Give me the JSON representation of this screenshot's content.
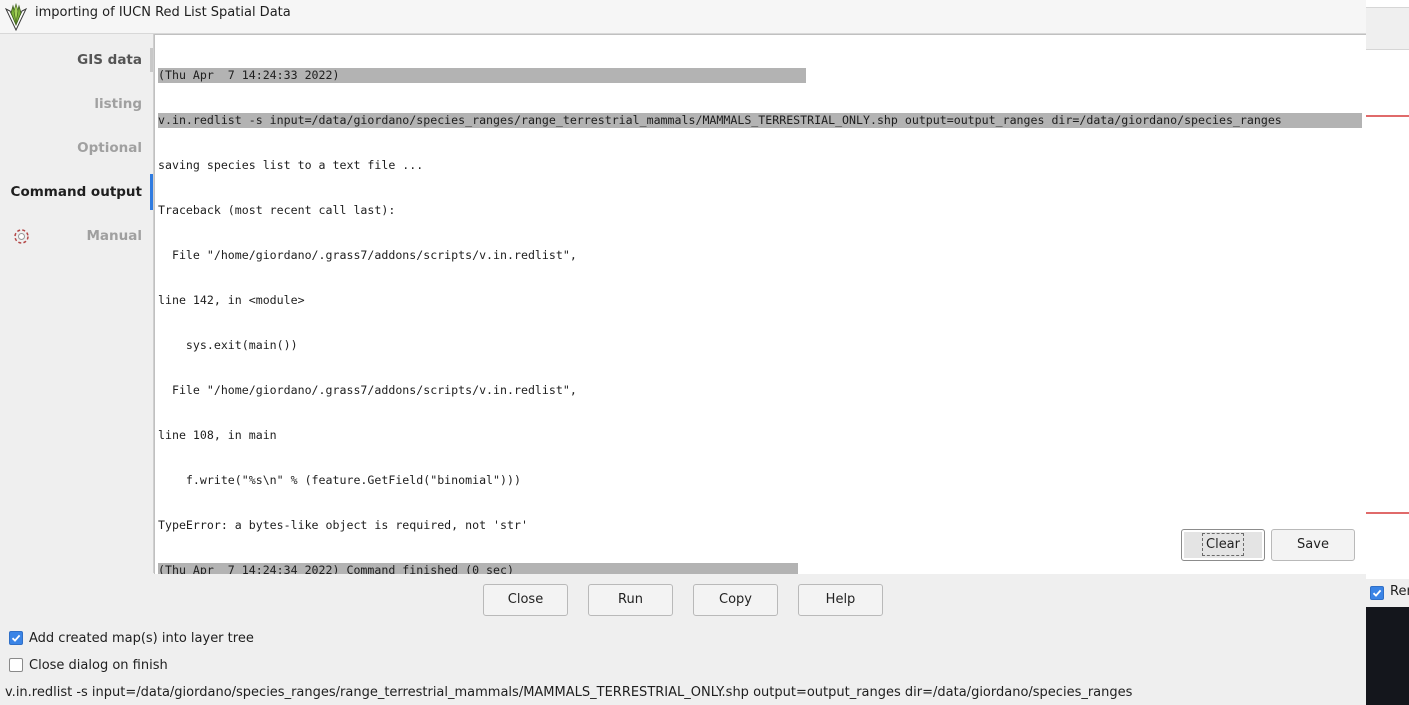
{
  "window": {
    "title": "importing of IUCN Red List Spatial Data"
  },
  "sidebar": {
    "items": [
      {
        "label": "GIS data"
      },
      {
        "label": "listing"
      },
      {
        "label": "Optional"
      },
      {
        "label": "Command output"
      },
      {
        "label": "Manual"
      }
    ]
  },
  "output": {
    "lines": [
      "(Thu Apr  7 14:24:33 2022)",
      "v.in.redlist -s input=/data/giordano/species_ranges/range_terrestrial_mammals/MAMMALS_TERRESTRIAL_ONLY.shp output=output_ranges dir=/data/giordano/species_ranges",
      "saving species list to a text file ...",
      "Traceback (most recent call last):",
      "  File \"/home/giordano/.grass7/addons/scripts/v.in.redlist\",",
      "line 142, in <module>",
      "    sys.exit(main())",
      "  File \"/home/giordano/.grass7/addons/scripts/v.in.redlist\",",
      "line 108, in main",
      "    f.write(\"%s\\n\" % (feature.GetField(\"binomial\")))",
      "TypeError: a bytes-like object is required, not 'str'",
      "(Thu Apr  7 14:24:34 2022) Command finished (0 sec)"
    ],
    "clear_label": "Clear",
    "save_label": "Save"
  },
  "buttons": {
    "close": "Close",
    "run": "Run",
    "copy": "Copy",
    "help": "Help"
  },
  "options": {
    "add_to_layer_tree": {
      "label": "Add created map(s) into layer tree",
      "checked": true
    },
    "close_on_finish": {
      "label": "Close dialog on finish",
      "checked": false
    }
  },
  "command_line": "v.in.redlist -s input=/data/giordano/species_ranges/range_terrestrial_mammals/MAMMALS_TERRESTRIAL_ONLY.shp output=output_ranges dir=/data/giordano/species_ranges",
  "background_window": {
    "checkbox_label": "Ren"
  },
  "colors": {
    "accent": "#3a84e6",
    "highlight": "#b3b3b3",
    "active_tab_marker": "#2f7be0"
  }
}
